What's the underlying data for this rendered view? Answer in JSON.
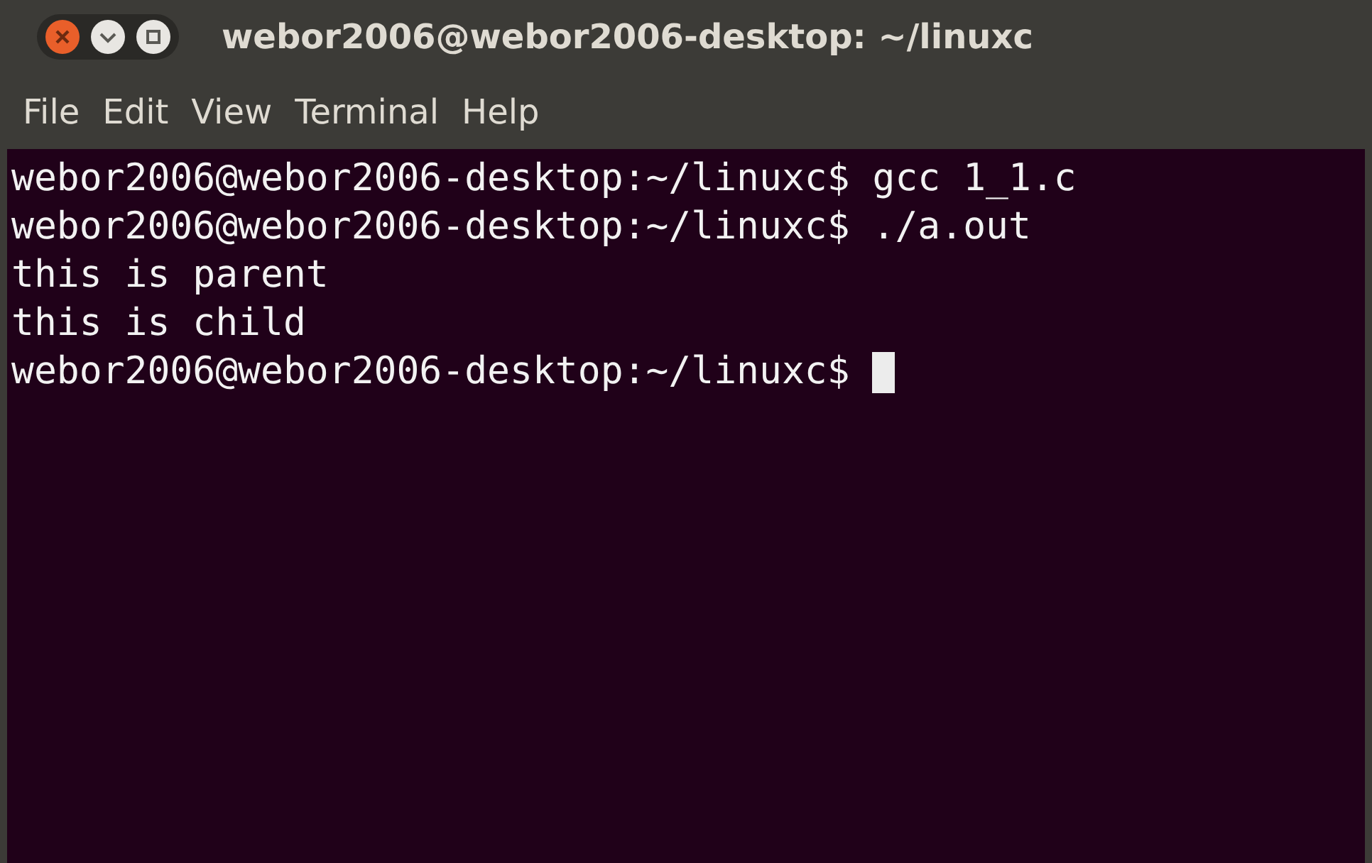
{
  "window": {
    "title": "webor2006@webor2006-desktop: ~/linuxc"
  },
  "menu": [
    "File",
    "Edit",
    "View",
    "Terminal",
    "Help"
  ],
  "terminal": {
    "lines": [
      "webor2006@webor2006-desktop:~/linuxc$ gcc 1_1.c",
      "webor2006@webor2006-desktop:~/linuxc$ ./a.out",
      "this is parent",
      "this is child",
      "webor2006@webor2006-desktop:~/linuxc$ "
    ],
    "cursor_visible": true
  }
}
